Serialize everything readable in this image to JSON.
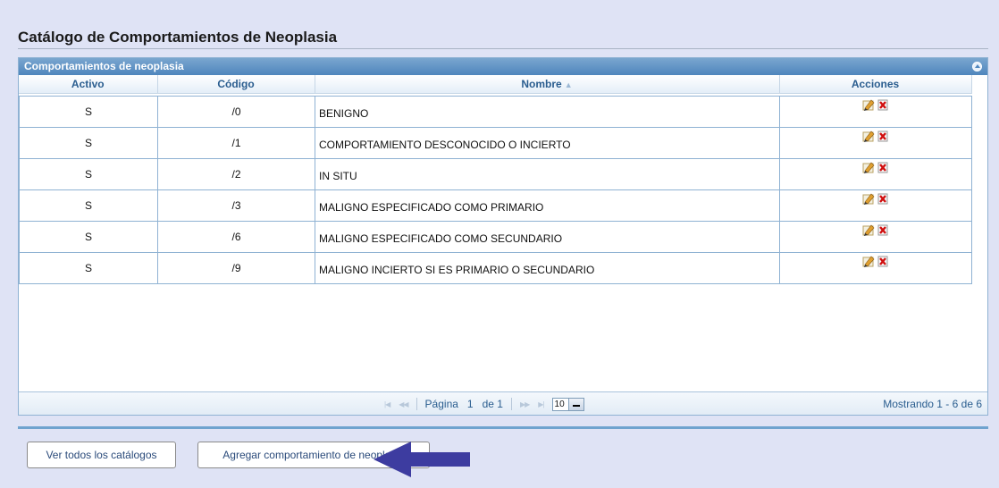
{
  "page_title": "Catálogo de Comportamientos de Neoplasia",
  "grid": {
    "caption": "Comportamientos de neoplasia",
    "columns": {
      "active": "Activo",
      "code": "Código",
      "name": "Nombre",
      "actions": "Acciones"
    },
    "rows": [
      {
        "active": "S",
        "code": "/0",
        "name": "BENIGNO"
      },
      {
        "active": "S",
        "code": "/1",
        "name": "COMPORTAMIENTO DESCONOCIDO O INCIERTO"
      },
      {
        "active": "S",
        "code": "/2",
        "name": "IN SITU"
      },
      {
        "active": "S",
        "code": "/3",
        "name": "MALIGNO ESPECIFICADO COMO PRIMARIO"
      },
      {
        "active": "S",
        "code": "/6",
        "name": "MALIGNO ESPECIFICADO COMO SECUNDARIO"
      },
      {
        "active": "S",
        "code": "/9",
        "name": "MALIGNO INCIERTO SI ES PRIMARIO O SECUNDARIO"
      }
    ],
    "row_icons": [
      "edit-icon",
      "delete-icon"
    ]
  },
  "pager": {
    "page_label": "Página",
    "page_value": "1",
    "of_label": "de 1",
    "page_size": "10",
    "records_text": "Mostrando 1 - 6 de 6"
  },
  "buttons": {
    "view_all": "Ver todos los catálogos",
    "add": "Agregar comportamiento de neoplasia"
  },
  "colors": {
    "caption_bar": "#4f86bd",
    "header_text": "#2a5d8f",
    "arrow": "#3d3ca0"
  }
}
